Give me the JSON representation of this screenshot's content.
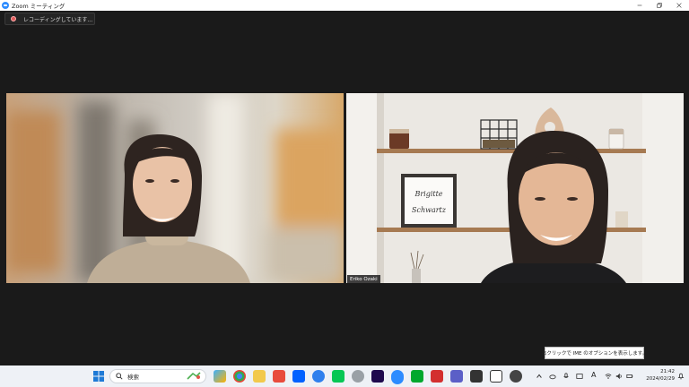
{
  "window": {
    "title": "Zoom ミーティング"
  },
  "recording": {
    "status_text": "レコーディングしています..."
  },
  "participants": [
    {
      "name": ""
    },
    {
      "name": "Eriko Ozaki"
    }
  ],
  "background_frame": {
    "text_line1": "Brigitte",
    "text_line2": "Schwartz"
  },
  "tooltip": {
    "text": "右クリックで IME のオプションを表示します。"
  },
  "taskbar": {
    "search_placeholder": "検索",
    "time": "21:42",
    "date": "2024/02/29",
    "ime_mode": "A",
    "accent": "#2d8cff"
  }
}
